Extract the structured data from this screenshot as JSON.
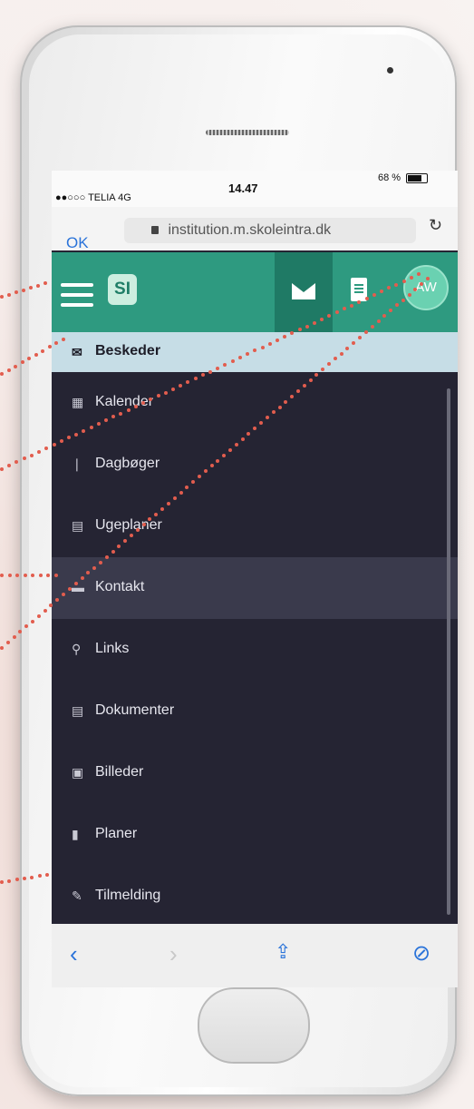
{
  "status_bar": {
    "carrier": "●●○○○ TELIA  4G",
    "time": "14.47",
    "battery": "68 %"
  },
  "browser": {
    "ok_label": "OK",
    "url": "institution.m.skoleintra.dk",
    "reload_icon": "reload-icon"
  },
  "app_bar": {
    "logo_text": "SI",
    "avatar_initials": "AW",
    "accent_color": "#2e9a80"
  },
  "menu": {
    "items": [
      {
        "label": "Beskeder",
        "icon": "envelope-icon",
        "glyph": "✉",
        "state": "active"
      },
      {
        "label": "Kalender",
        "icon": "calendar-icon",
        "glyph": "▦",
        "state": ""
      },
      {
        "label": "Dagbøger",
        "icon": "diary-icon",
        "glyph": "❘",
        "state": ""
      },
      {
        "label": "Ugeplaner",
        "icon": "weekplan-icon",
        "glyph": "▤",
        "state": ""
      },
      {
        "label": "Kontakt",
        "icon": "contact-card-icon",
        "glyph": "▬",
        "state": "highlighted"
      },
      {
        "label": "Links",
        "icon": "link-icon",
        "glyph": "⚲",
        "state": ""
      },
      {
        "label": "Dokumenter",
        "icon": "document-icon",
        "glyph": "▤",
        "state": ""
      },
      {
        "label": "Billeder",
        "icon": "images-icon",
        "glyph": "▣",
        "state": ""
      },
      {
        "label": "Planer",
        "icon": "clipboard-icon",
        "glyph": "▮",
        "state": ""
      },
      {
        "label": "Tilmelding",
        "icon": "signup-icon",
        "glyph": "✎",
        "state": ""
      }
    ]
  },
  "toolbar": {
    "back_glyph": "‹",
    "forward_glyph": "›",
    "share_glyph": "⇪",
    "compass_glyph": "⊘"
  }
}
